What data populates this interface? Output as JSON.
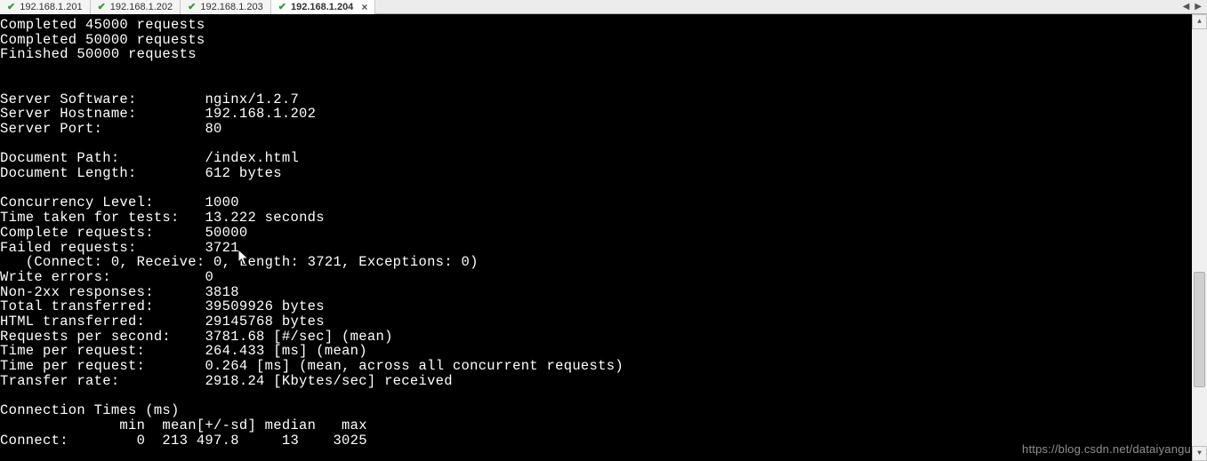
{
  "tabs": [
    {
      "label": "192.168.1.201",
      "active": false
    },
    {
      "label": "192.168.1.202",
      "active": false
    },
    {
      "label": "192.168.1.203",
      "active": false
    },
    {
      "label": "192.168.1.204",
      "active": true
    }
  ],
  "close_glyph": "×",
  "nav": {
    "prev": "◀",
    "next": "▶"
  },
  "scroll": {
    "up": "▲",
    "down": "▼"
  },
  "terminal": {
    "progress": [
      "Completed 45000 requests",
      "Completed 50000 requests",
      "Finished 50000 requests"
    ],
    "server": {
      "software_label": "Server Software:",
      "software": "nginx/1.2.7",
      "hostname_label": "Server Hostname:",
      "hostname": "192.168.1.202",
      "port_label": "Server Port:",
      "port": "80"
    },
    "doc": {
      "path_label": "Document Path:",
      "path": "/index.html",
      "length_label": "Document Length:",
      "length": "612 bytes"
    },
    "stats": {
      "concurrency_label": "Concurrency Level:",
      "concurrency": "1000",
      "time_taken_label": "Time taken for tests:",
      "time_taken": "13.222 seconds",
      "complete_label": "Complete requests:",
      "complete": "50000",
      "failed_label": "Failed requests:",
      "failed": "3721",
      "failed_detail": "   (Connect: 0, Receive: 0, Length: 3721, Exceptions: 0)",
      "write_errors_label": "Write errors:",
      "write_errors": "0",
      "non2xx_label": "Non-2xx responses:",
      "non2xx": "3818",
      "total_trans_label": "Total transferred:",
      "total_trans": "39509926 bytes",
      "html_trans_label": "HTML transferred:",
      "html_trans": "29145768 bytes",
      "rps_label": "Requests per second:",
      "rps": "3781.68 [#/sec] (mean)",
      "tpr1_label": "Time per request:",
      "tpr1": "264.433 [ms] (mean)",
      "tpr2_label": "Time per request:",
      "tpr2": "0.264 [ms] (mean, across all concurrent requests)",
      "rate_label": "Transfer rate:",
      "rate": "2918.24 [Kbytes/sec] received"
    },
    "conn_header": "Connection Times (ms)",
    "conn_cols": "              min  mean[+/-sd] median   max",
    "conn_row": "Connect:        0  213 497.8     13    3025"
  },
  "watermark": "https://blog.csdn.net/dataiyangu"
}
